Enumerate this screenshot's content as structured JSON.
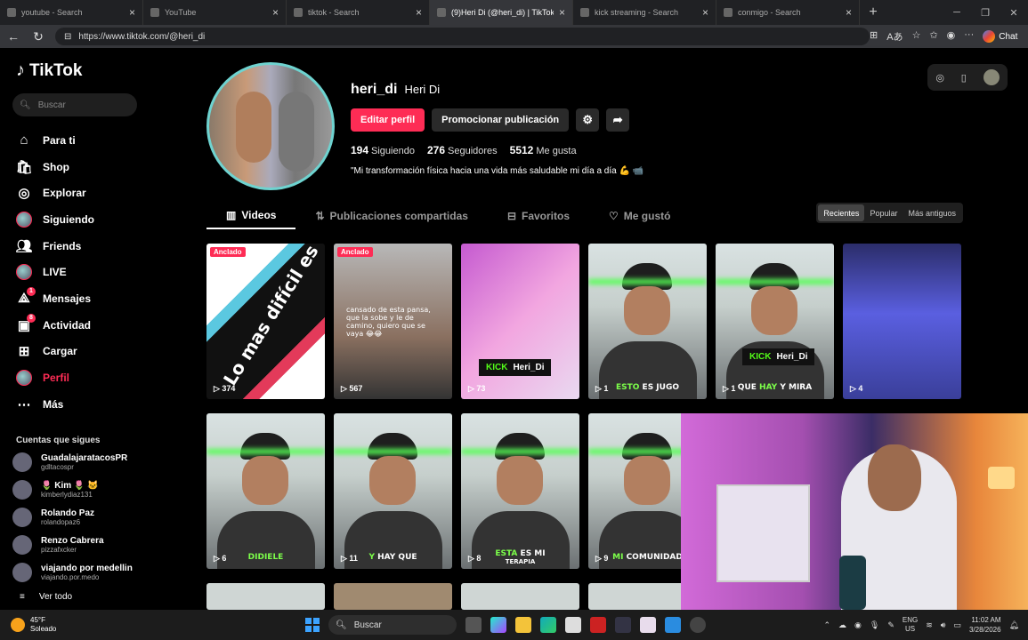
{
  "browser": {
    "tabs": [
      {
        "title": "youtube - Search",
        "active": false
      },
      {
        "title": "YouTube",
        "active": false
      },
      {
        "title": "tiktok - Search",
        "active": false
      },
      {
        "title": "(9)Heri Di (@heri_di) | TikTok",
        "active": true
      },
      {
        "title": "kick streaming - Search",
        "active": false
      },
      {
        "title": "conmigo - Search",
        "active": false
      }
    ],
    "url": "https://www.tiktok.com/@heri_di",
    "chat_label": "Chat"
  },
  "sidebar": {
    "logo": "TikTok",
    "search_placeholder": "Buscar",
    "items": [
      {
        "label": "Para ti",
        "icon": "home-icon"
      },
      {
        "label": "Shop",
        "icon": "shop-icon"
      },
      {
        "label": "Explorar",
        "icon": "compass-icon"
      },
      {
        "label": "Siguiendo",
        "icon": "following-avatar-icon"
      },
      {
        "label": "Friends",
        "icon": "friends-icon"
      },
      {
        "label": "LIVE",
        "icon": "live-icon"
      },
      {
        "label": "Mensajes",
        "icon": "messages-icon",
        "badge": "1"
      },
      {
        "label": "Actividad",
        "icon": "activity-icon",
        "badge": "8"
      },
      {
        "label": "Cargar",
        "icon": "upload-icon"
      },
      {
        "label": "Perfil",
        "icon": "profile-avatar-icon",
        "active": true
      },
      {
        "label": "Más",
        "icon": "more-icon"
      }
    ],
    "following_header": "Cuentas que sigues",
    "following": [
      {
        "name": "GuadalajaratacosPR",
        "handle": "gdltacospr"
      },
      {
        "name": "🌷 Kim 🌷 🐱",
        "handle": "kimberlydiaz131"
      },
      {
        "name": "Rolando Paz",
        "handle": "rolandopaz6"
      },
      {
        "name": "Renzo Cabrera",
        "handle": "pizzafxcker"
      },
      {
        "name": "viajando por medellin",
        "handle": "viajando.por.medo"
      }
    ],
    "see_all": "Ver todo"
  },
  "profile": {
    "username": "heri_di",
    "nickname": "Heri Di",
    "edit_button": "Editar perfil",
    "promote_button": "Promocionar publicación",
    "following_count": "194",
    "following_label": "Siguiendo",
    "followers_count": "276",
    "followers_label": "Seguidores",
    "likes_count": "5512",
    "likes_label": "Me gusta",
    "bio": "\"Mi transformación física hacia una vida más saludable mi día a día 💪 📹"
  },
  "content_tabs": [
    {
      "label": "Videos",
      "active": true
    },
    {
      "label": "Publicaciones compartidas",
      "active": false
    },
    {
      "label": "Favoritos",
      "active": false
    },
    {
      "label": "Me gustó",
      "active": false
    }
  ],
  "sort": {
    "options": [
      "Recientes",
      "Popular",
      "Más antiguos"
    ],
    "selected": "Recientes"
  },
  "videos_row1": [
    {
      "views": "374",
      "pinned": "Anclado",
      "overlay": "Lo mas difícil es empezar"
    },
    {
      "views": "567",
      "pinned": "Anclado",
      "overlay": "cansado de esta pansa, que la sobe y le de camino, quiero que se vaya 😂😂"
    },
    {
      "views": "73",
      "kick": "KICK",
      "kick_name": "Heri_Di"
    },
    {
      "views": "1",
      "cap_green": "ESTO",
      "cap": "ES JUGO"
    },
    {
      "views": "1",
      "kick": "KICK",
      "kick_name": "Heri_Di",
      "cap_green": "HAY",
      "cap_pre": "QUE",
      "cap": "Y MIRA"
    },
    {
      "views": "4"
    }
  ],
  "videos_row2": [
    {
      "views": "6",
      "cap_green": "DIDIELE"
    },
    {
      "views": "11",
      "cap_green": "Y",
      "cap": "HAY QUE"
    },
    {
      "views": "8",
      "cap_green": "ESTA",
      "cap": "ES MI",
      "cap2": "TERAPIA"
    },
    {
      "views": "9",
      "cap_green": "MI",
      "cap": "COMUNIDAD"
    }
  ],
  "taskbar": {
    "weather_temp": "45°F",
    "weather_desc": "Soleado",
    "search_label": "Buscar",
    "lang": "ENG",
    "region": "US",
    "time": "11:02 AM",
    "date": "3/28/2026"
  }
}
